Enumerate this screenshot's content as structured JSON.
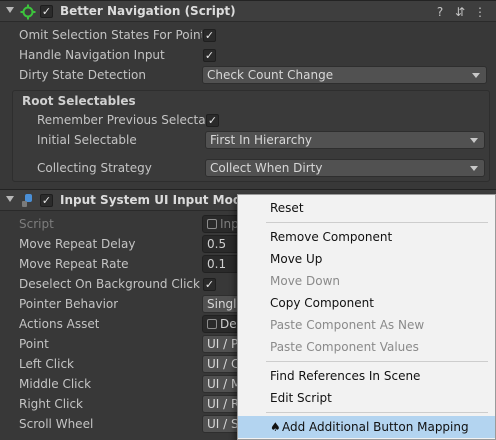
{
  "component1": {
    "title": "Better Navigation (Script)",
    "enabled_mark": "✓",
    "rows": {
      "omit": "Omit Selection States For Pointe",
      "handle_nav": "Handle Navigation Input",
      "dirty": "Dirty State Detection",
      "dirty_value": "Check Count Change",
      "root_header": "Root Selectables",
      "remember": "Remember Previous Selectab",
      "initial": "Initial Selectable",
      "initial_value": "First In Hierarchy",
      "collecting": "Collecting Strategy",
      "collecting_value": "Collect When Dirty"
    },
    "check": "✓"
  },
  "component2": {
    "title": "Input System UI Input Module",
    "enabled_mark": "✓",
    "rows": {
      "script": "Script",
      "script_value": "Inp",
      "move_delay": "Move Repeat Delay",
      "move_delay_value": "0.5",
      "move_rate": "Move Repeat Rate",
      "move_rate_value": "0.1",
      "deselect": "Deselect On Background Click",
      "pointer": "Pointer Behavior",
      "pointer_value": "Single",
      "actions": "Actions Asset",
      "actions_value": "De",
      "point": "Point",
      "point_value": "UI / P",
      "left": "Left Click",
      "left_value": "UI / C",
      "middle": "Middle Click",
      "middle_value": "UI / M",
      "right": "Right Click",
      "right_value": "UI / R",
      "scroll": "Scroll Wheel",
      "scroll_value": "UI / S"
    },
    "check": "✓"
  },
  "header_icons": [
    "help-icon",
    "presets-icon",
    "more-icon"
  ],
  "header_glyphs": {
    "help": "?",
    "presets": "⇵",
    "more": "⋮"
  },
  "context_menu": {
    "items": [
      "Reset",
      "Remove Component",
      "Move Up",
      "Move Down",
      "Copy Component",
      "Paste Component As New",
      "Paste Component Values",
      "Find References In Scene",
      "Edit Script",
      "Add Additional Button Mapping"
    ],
    "highlight_glyph": "♠"
  },
  "colors": {
    "inspector_bg": "#383838",
    "menu_bg": "#f2f2f2",
    "menu_highlight": "#b3d4f0",
    "script_icon": "#3cc43c",
    "module_icon": "#4a8fd6"
  }
}
